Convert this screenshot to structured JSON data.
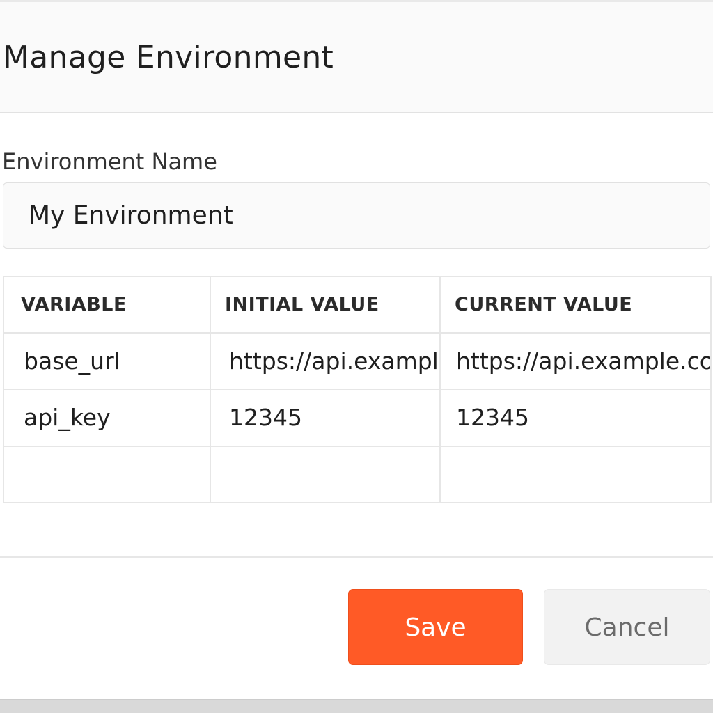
{
  "dialog": {
    "title": "Manage Environment"
  },
  "form": {
    "name_label": "Environment Name",
    "name_value": "My Environment"
  },
  "table": {
    "headers": [
      "VARIABLE",
      "INITIAL VALUE",
      "CURRENT VALUE"
    ],
    "rows": [
      [
        "base_url",
        "https://api.example.com",
        "https://api.example.com"
      ],
      [
        "api_key",
        "12345",
        "12345"
      ],
      [
        "",
        "",
        ""
      ]
    ]
  },
  "footer": {
    "save_label": "Save",
    "cancel_label": "Cancel"
  },
  "colors": {
    "accent": "#ff5a26",
    "cancel_bg": "#f2f2f2",
    "header_bg": "#fafafa"
  }
}
